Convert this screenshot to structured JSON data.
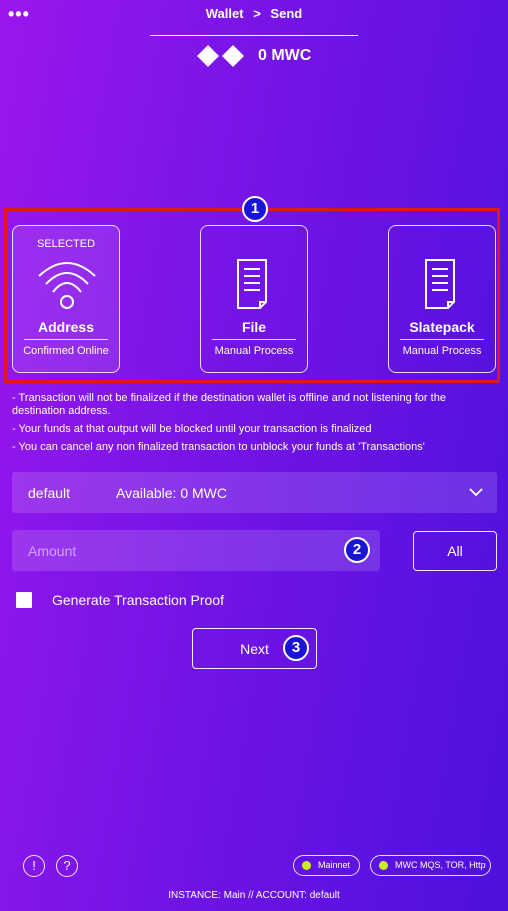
{
  "header": {
    "menu_icon": "more-dots-icon",
    "breadcrumb": [
      "Wallet",
      ">",
      "Send"
    ],
    "logo_icon": "mwc-logo-icon",
    "balance": "0 MWC"
  },
  "markers": [
    "1",
    "2",
    "3"
  ],
  "methods": [
    {
      "top_label": "SELECTED",
      "title": "Address",
      "subtitle": "Confirmed Online",
      "icon": "wifi-icon",
      "selected": true
    },
    {
      "top_label": "",
      "title": "File",
      "subtitle": "Manual Process",
      "icon": "file-icon",
      "selected": false
    },
    {
      "top_label": "",
      "title": "Slatepack",
      "subtitle": "Manual Process",
      "icon": "file-icon",
      "selected": false
    }
  ],
  "notes": [
    "- Transaction will not be finalized if the destination wallet is offline and not listening for the destination address.",
    "- Your funds at that output will be blocked until your transaction is finalized",
    "- You can cancel any non finalized transaction to unblock your funds at 'Transactions'"
  ],
  "account_select": {
    "account": "default",
    "available": "Available: 0 MWC",
    "icon": "chevron-down-icon"
  },
  "amount": {
    "placeholder": "Amount",
    "value": ""
  },
  "all_label": "All",
  "proof": {
    "label": "Generate Transaction Proof",
    "checked": false
  },
  "next_label": "Next",
  "footer": {
    "alert_glyph": "!",
    "help_glyph": "?",
    "network": "Mainnet",
    "transports": "MWC MQS, TOR, Http",
    "instance_line": "INSTANCE:  Main  //  ACCOUNT:  default",
    "status_color": "#c8ef1b"
  }
}
